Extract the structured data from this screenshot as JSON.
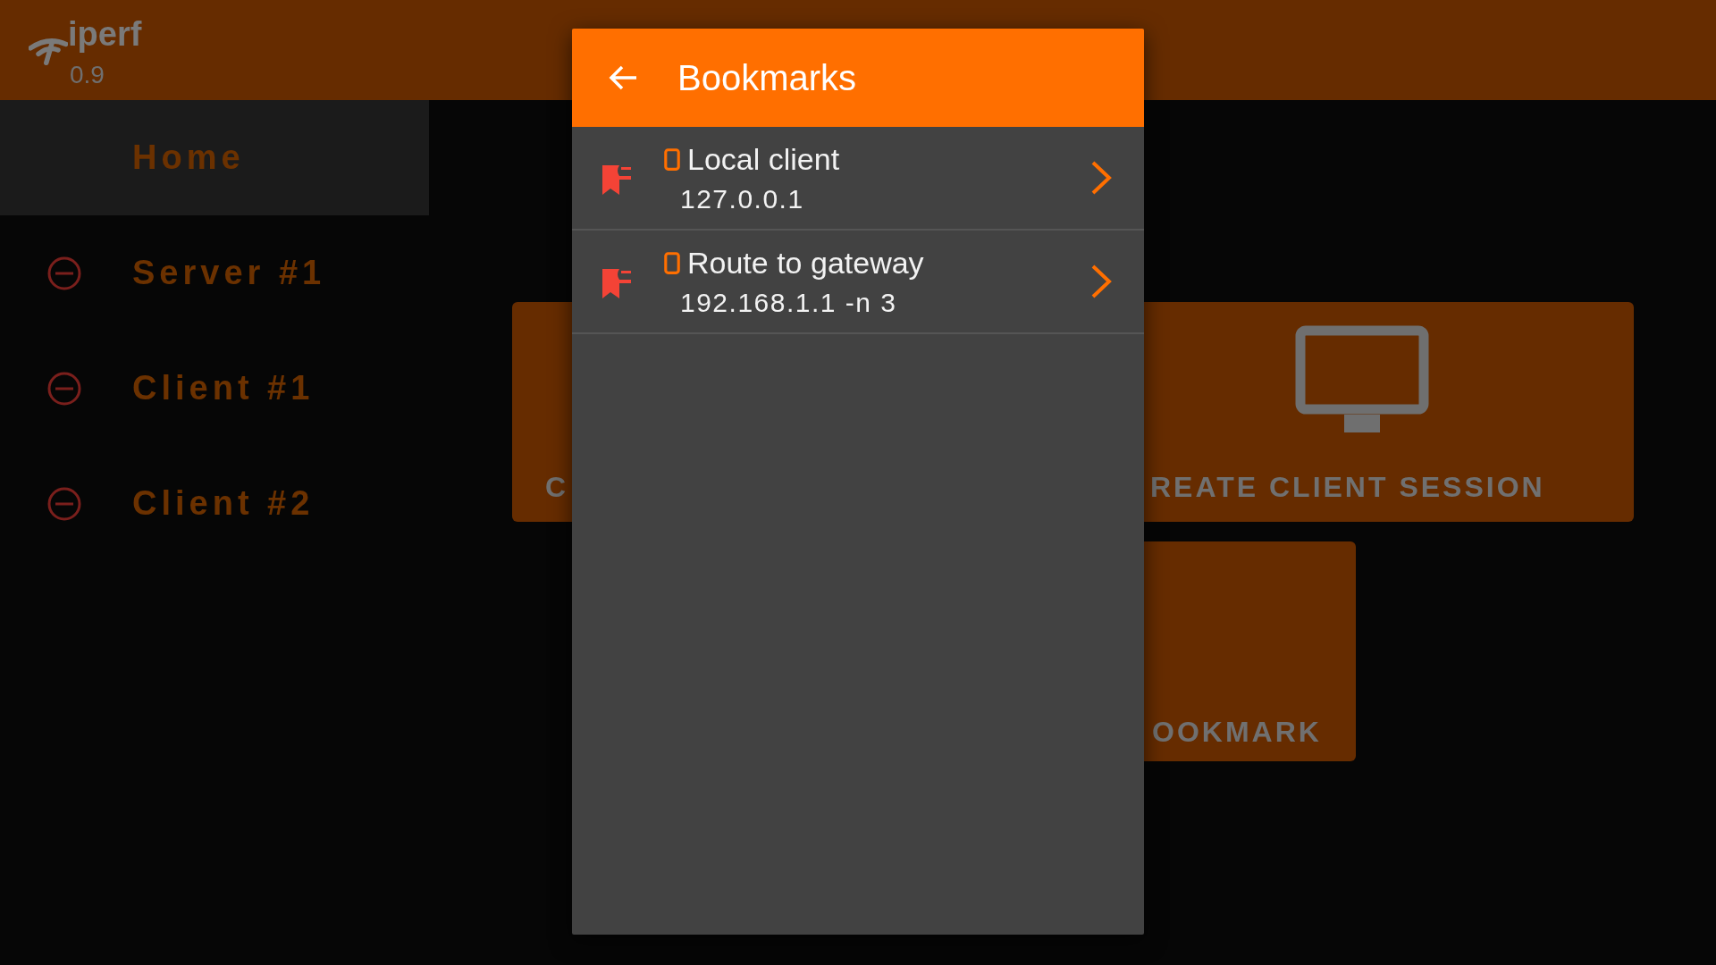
{
  "app_bar": {
    "title": "iperf",
    "version": "0.9"
  },
  "sidebar": {
    "items": [
      {
        "label": "Home",
        "kind": "home",
        "selected": true
      },
      {
        "label": "Server #1",
        "kind": "session",
        "selected": false
      },
      {
        "label": "Client #1",
        "kind": "session",
        "selected": false
      },
      {
        "label": "Client #2",
        "kind": "session",
        "selected": false
      }
    ]
  },
  "cards": [
    {
      "label": "C",
      "kind": "plain"
    },
    {
      "label": "REATE CLIENT SESSION",
      "kind": "monitor"
    },
    {
      "label": "OOKMARK",
      "kind": "plain"
    }
  ],
  "dialog": {
    "title": "Bookmarks",
    "bookmarks": [
      {
        "name": "Local client",
        "address": "127.0.0.1"
      },
      {
        "name": "Route to gateway",
        "address": "192.168.1.1 -n 3"
      }
    ]
  }
}
